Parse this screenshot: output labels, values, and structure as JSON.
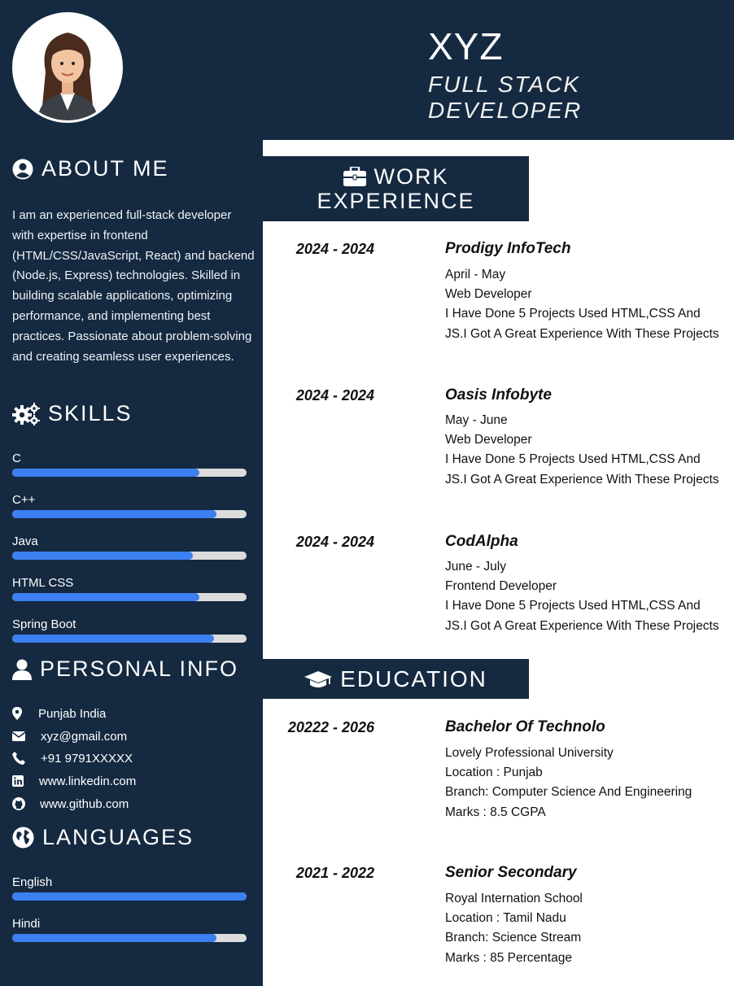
{
  "header": {
    "name": "XYZ",
    "role": "FULL STACK DEVELOPER"
  },
  "about": {
    "title": "ABOUT ME",
    "icon": "user-circle-icon",
    "text": "I am an experienced full-stack developer with expertise in frontend (HTML/CSS/JavaScript, React) and backend (Node.js, Express) technologies. Skilled in building scalable applications, optimizing performance, and implementing best practices. Passionate about problem-solving and creating seamless user experiences."
  },
  "skills": {
    "title": "SKILLS",
    "icon": "gears-icon",
    "items": [
      {
        "label": "C",
        "level": 0.8
      },
      {
        "label": "C++",
        "level": 0.87
      },
      {
        "label": "Java",
        "level": 0.77
      },
      {
        "label": "HTML CSS",
        "level": 0.8
      },
      {
        "label": "Spring Boot",
        "level": 0.86
      }
    ]
  },
  "personal": {
    "title": "PERSONAL INFO",
    "icon": "user-icon",
    "items": [
      {
        "icon": "map-pin-icon",
        "text": "Punjab India"
      },
      {
        "icon": "envelope-icon",
        "text": "xyz@gmail.com"
      },
      {
        "icon": "phone-icon",
        "text": "+91 9791XXXXX"
      },
      {
        "icon": "linkedin-icon",
        "text": "www.linkedin.com"
      },
      {
        "icon": "github-icon",
        "text": "www.github.com"
      }
    ]
  },
  "languages": {
    "title": "LANGUAGES",
    "icon": "globe-icon",
    "items": [
      {
        "label": "English",
        "level": 1.0
      },
      {
        "label": "Hindi",
        "level": 0.87
      }
    ]
  },
  "work": {
    "title_line1": "WORK",
    "title_line2": "EXPERIENCE",
    "icon": "briefcase-icon",
    "entries": [
      {
        "date": "2024 - 2024",
        "company": "Prodigy InfoTech",
        "lines": [
          "April - May",
          "Web Developer",
          "I Have Done 5 Projects Used HTML,CSS And",
          "JS.I Got A Great Experience With These Projects"
        ]
      },
      {
        "date": "2024 - 2024",
        "company": "Oasis Infobyte",
        "lines": [
          "May - June",
          "Web Developer",
          "I Have Done 5 Projects Used HTML,CSS And",
          "JS.I Got A Great Experience With These Projects"
        ]
      },
      {
        "date": "2024 - 2024",
        "company": "CodAlpha",
        "lines": [
          "June - July",
          "Frontend Developer",
          "I Have Done 5 Projects Used HTML,CSS And",
          "JS.I Got A Great Experience With These Projects"
        ]
      }
    ]
  },
  "education": {
    "title": "EDUCATION",
    "icon": "graduation-cap-icon",
    "entries": [
      {
        "date": "20222 - 2026",
        "degree": "Bachelor Of Technolo",
        "lines": [
          "Lovely Professional University",
          "Location : Punjab",
          "Branch: Computer Science And Engineering",
          "Marks : 8.5 CGPA"
        ]
      },
      {
        "date": "2021 - 2022",
        "degree": "Senior Secondary",
        "lines": [
          "Royal Internation School",
          "Location : Tamil Nadu",
          "Branch: Science Stream",
          "Marks : 85 Percentage"
        ]
      }
    ]
  },
  "colors": {
    "navy": "#152a41",
    "accent": "#3b7ff0",
    "track": "#dcdcdc"
  }
}
